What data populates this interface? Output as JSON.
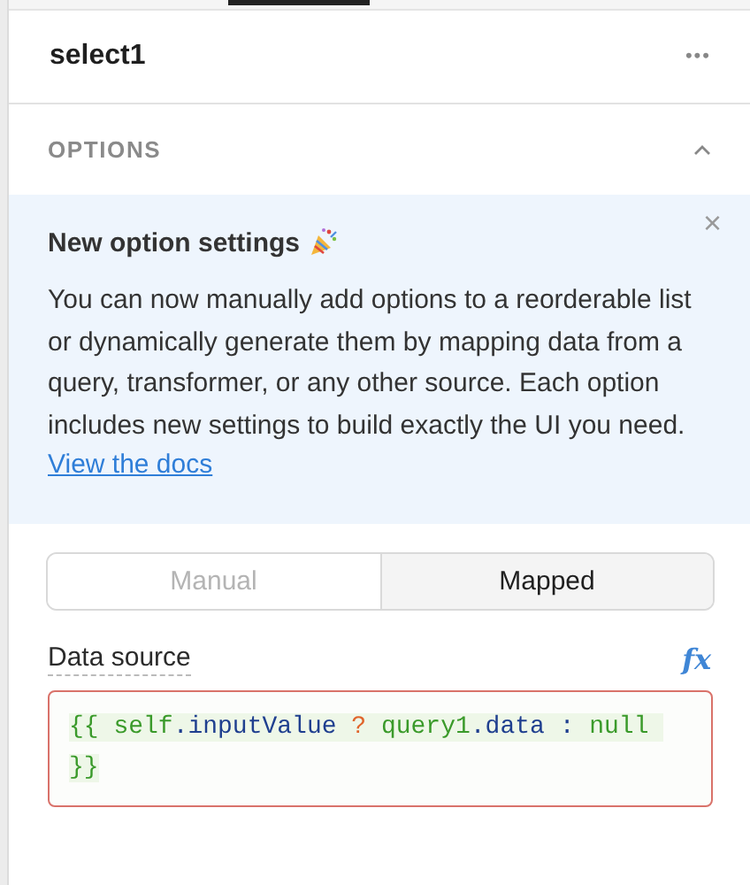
{
  "header": {
    "title": "select1",
    "menu": "•••"
  },
  "section": {
    "title": "OPTIONS",
    "expanded": true
  },
  "banner": {
    "title": "New option settings",
    "body": "You can now manually add options to a reorderable list or dynamically generate them by mapping data from a query, transformer, or any other source. Each option includes new settings to build exactly the UI you need.",
    "link": "View the docs",
    "close": "×"
  },
  "modes": [
    {
      "label": "Manual",
      "selected": false
    },
    {
      "label": "Mapped",
      "selected": true
    }
  ],
  "data_source": {
    "label": "Data source",
    "fx": "fx",
    "error": true,
    "lines": [
      [
        {
          "kind": "brace",
          "text": "{{ "
        },
        {
          "kind": "name",
          "text": "self"
        },
        {
          "kind": "member",
          "text": ".inputValue "
        },
        {
          "kind": "ternary",
          "text": "? "
        },
        {
          "kind": "name",
          "text": "query1"
        },
        {
          "kind": "member",
          "text": ".data "
        },
        {
          "kind": "colon",
          "text": ": "
        },
        {
          "kind": "keyword",
          "text": "null "
        }
      ],
      [
        {
          "kind": "brace",
          "text": "}}"
        }
      ]
    ]
  }
}
